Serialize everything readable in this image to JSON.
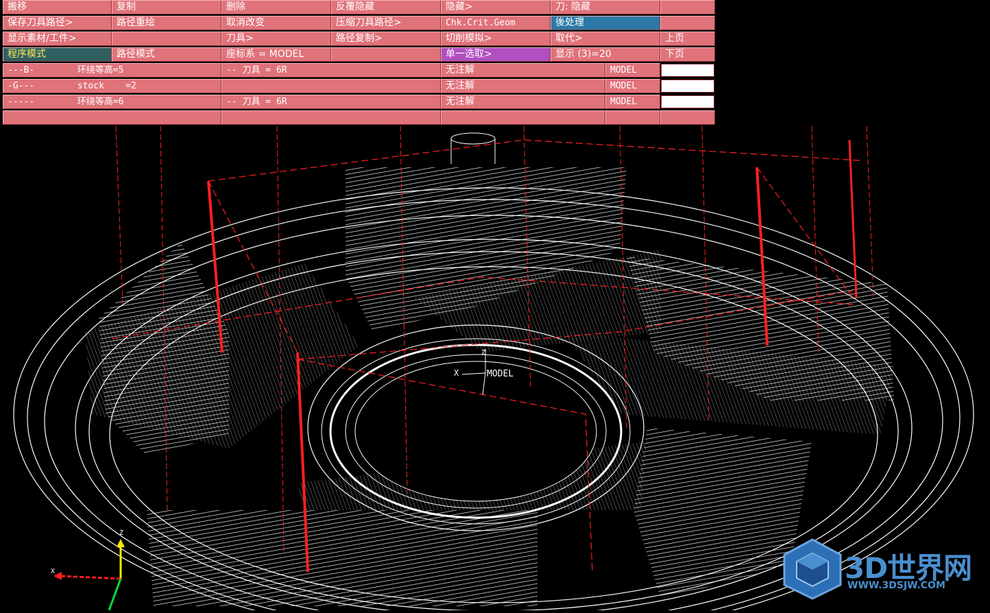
{
  "menu": {
    "row1": [
      "搬移",
      "复制",
      "删除",
      "反覆隐藏",
      "隐藏>",
      "刀: 隐藏",
      ""
    ],
    "row2": [
      "保存刀具路径>",
      "路径重绘",
      "取消改变",
      "压缩刀具路径>",
      "Chk.Crit.Geom",
      "後处理",
      ""
    ],
    "row3": [
      "显示素材/工件>",
      "",
      "刀具>",
      "路径复制>",
      "切削模拟>",
      "取代>",
      "上页"
    ],
    "row4": [
      "程序模式",
      "路径模式",
      "座标系 = MODEL",
      "",
      "单一选取>",
      "显示 (3)=20",
      "下页"
    ]
  },
  "ops": [
    {
      "id": "---B-",
      "name": "环绕等高=5",
      "tool": "-- 刀具 = 6R",
      "note": "无注解",
      "cs": "MODEL"
    },
    {
      "id": "-G---",
      "name": "stock    =2",
      "tool": "",
      "note": "无注解",
      "cs": "MODEL"
    },
    {
      "id": "-----",
      "name": "环绕等高=6",
      "tool": "-- 刀具 = 6R",
      "note": "无注解",
      "cs": "MODEL"
    }
  ],
  "viewport": {
    "origin_label": "MODEL",
    "axis_x": "X",
    "axis_z": "Z",
    "triad_x": "X",
    "triad_z": "Z"
  },
  "watermark": {
    "brand": "3D世界网",
    "url": "WWW.3DSJW.COM"
  },
  "colors": {
    "menu_bg": "#e0727a",
    "active": "#2f5f60",
    "highlight_blue": "#2c79a8",
    "highlight_purple": "#b14fc1",
    "toolpath": "#ff2020",
    "wire": "#ffffff",
    "brand": "#4a8fcf"
  }
}
